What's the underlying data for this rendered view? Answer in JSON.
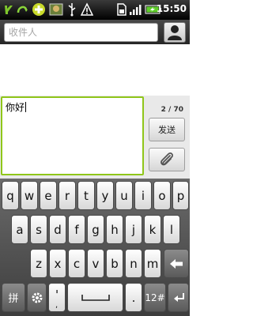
{
  "status": {
    "time": "15:50",
    "icons": [
      "missed-call-icon",
      "sync-icon",
      "plus-notification-icon",
      "photo-notification-icon",
      "usb-icon",
      "warning-icon",
      "sim-card-icon",
      "signal-icon",
      "battery-charging-icon"
    ]
  },
  "compose": {
    "to_placeholder": "收件人",
    "message": "你好",
    "char_count": "2 / 70",
    "send_label": "发送"
  },
  "keyboard": {
    "row1": [
      "q",
      "w",
      "e",
      "r",
      "t",
      "y",
      "u",
      "i",
      "o",
      "p"
    ],
    "row2": [
      "a",
      "s",
      "d",
      "f",
      "g",
      "h",
      "j",
      "k",
      "l"
    ],
    "row3": [
      "z",
      "x",
      "c",
      "v",
      "b",
      "n",
      "m"
    ],
    "pinyin_label": "拼",
    "numbers_label": "12#",
    "apostrophe_label": "'",
    "comma_label": ",",
    "period_label": "."
  }
}
